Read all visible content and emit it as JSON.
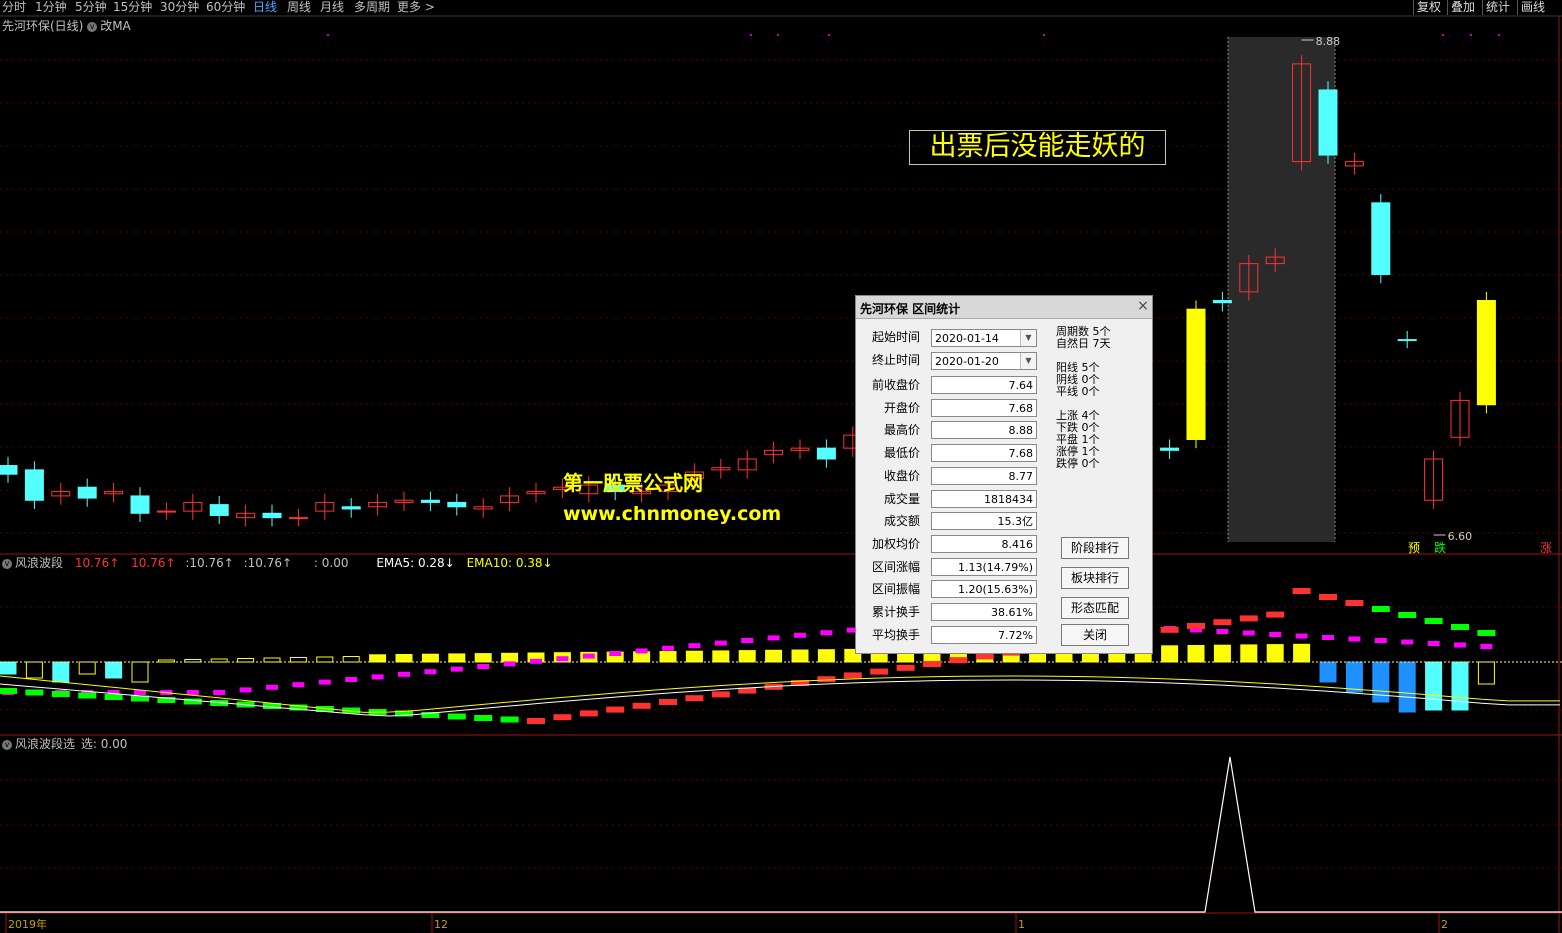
{
  "toolbar": {
    "periods": [
      "分时",
      "1分钟",
      "5分钟",
      "15分钟",
      "30分钟",
      "60分钟",
      "日线",
      "周线",
      "月线",
      "多周期",
      "更多 >"
    ],
    "active_period": "日线",
    "right_buttons": [
      "复权",
      "叠加",
      "统计",
      "画线"
    ]
  },
  "main_panel": {
    "title": "先河环保(日线)",
    "indicator": "改MA",
    "high_label": "8.88",
    "low_label": "6.60"
  },
  "annotation": "出票后没能走妖的",
  "watermark": {
    "line1": "第一股票公式网",
    "line2": "www.chnmoney.com"
  },
  "signals": {
    "yu": "预",
    "die": "跌",
    "zhang": "涨"
  },
  "sub_panel1": {
    "name": "风浪波段",
    "values": [
      "10.76↑",
      "10.76↑",
      ":10.76↑",
      ":10.76↑",
      ": 0.00"
    ],
    "ema5": "EMA5: 0.28↓",
    "ema10": "EMA10: 0.38↓"
  },
  "sub_panel2": {
    "name": "风浪波段选",
    "value": "选: 0.00"
  },
  "x_axis": [
    "2019年",
    "12",
    "1",
    "2"
  ],
  "dialog": {
    "title": "先河环保 区间统计",
    "start_label": "起始时间",
    "start_value": "2020-01-14",
    "end_label": "终止时间",
    "end_value": "2020-01-20",
    "fields": [
      {
        "label": "前收盘价",
        "value": "7.64"
      },
      {
        "label": "开盘价",
        "value": "7.68"
      },
      {
        "label": "最高价",
        "value": "8.88"
      },
      {
        "label": "最低价",
        "value": "7.68"
      },
      {
        "label": "收盘价",
        "value": "8.77"
      },
      {
        "label": "成交量",
        "value": "1818434"
      },
      {
        "label": "成交额",
        "value": "15.3亿"
      },
      {
        "label": "加权均价",
        "value": "8.416"
      },
      {
        "label": "区间涨幅",
        "value": "1.13(14.79%)"
      },
      {
        "label": "区间振幅",
        "value": "1.20(15.63%)"
      },
      {
        "label": "累计换手",
        "value": "38.61%"
      },
      {
        "label": "平均换手",
        "value": "7.72%"
      }
    ],
    "stats": [
      "周期数 5个",
      "自然日 7天",
      "阳线 5个",
      "阴线 0个",
      "平线 0个",
      "上涨 4个",
      "下跌 0个",
      "平盘 1个",
      "涨停 1个",
      "跌停 0个"
    ],
    "buttons": [
      "阶段排行",
      "板块排行",
      "形态匹配",
      "关闭"
    ]
  },
  "colors": {
    "up": "#ff3232",
    "down": "#54ffff",
    "yellow": "#ffff00",
    "magenta": "#ff00ff",
    "green": "#00ff00",
    "blue": "#1e90ff"
  },
  "chart_data": {
    "type": "candlestick",
    "candles_approx": [
      {
        "o": 6.92,
        "c": 6.88
      },
      {
        "o": 6.9,
        "c": 6.76
      },
      {
        "o": 6.78,
        "c": 6.8
      },
      {
        "o": 6.82,
        "c": 6.77
      },
      {
        "o": 6.79,
        "c": 6.8
      },
      {
        "o": 6.78,
        "c": 6.7
      },
      {
        "o": 6.71,
        "c": 6.71
      },
      {
        "o": 6.71,
        "c": 6.75
      },
      {
        "o": 6.74,
        "c": 6.69
      },
      {
        "o": 6.68,
        "c": 6.7
      },
      {
        "o": 6.7,
        "c": 6.68
      },
      {
        "o": 6.68,
        "c": 6.68
      },
      {
        "o": 6.71,
        "c": 6.75
      },
      {
        "o": 6.73,
        "c": 6.72
      },
      {
        "o": 6.73,
        "c": 6.75
      },
      {
        "o": 6.75,
        "c": 6.76
      },
      {
        "o": 6.76,
        "c": 6.75
      },
      {
        "o": 6.75,
        "c": 6.73
      },
      {
        "o": 6.72,
        "c": 6.73
      },
      {
        "o": 6.75,
        "c": 6.78
      },
      {
        "o": 6.79,
        "c": 6.8
      },
      {
        "o": 6.81,
        "c": 6.82
      },
      {
        "o": 6.79,
        "c": 6.83
      },
      {
        "o": 6.83,
        "c": 6.8
      },
      {
        "o": 6.79,
        "c": 6.8
      },
      {
        "o": 6.8,
        "c": 6.83
      },
      {
        "o": 6.86,
        "c": 6.89
      },
      {
        "o": 6.9,
        "c": 6.91
      },
      {
        "o": 6.9,
        "c": 6.95
      },
      {
        "o": 6.97,
        "c": 6.99
      },
      {
        "o": 6.99,
        "c": 7.0
      },
      {
        "o": 7.0,
        "c": 6.95
      },
      {
        "o": 7.0,
        "c": 7.06
      },
      {
        "o": 7.1,
        "c": 7.07
      },
      {
        "o": 7.1,
        "c": 7.08
      },
      {
        "o": 7.12,
        "c": 7.11
      },
      {
        "o": 7.1,
        "c": 7.13
      },
      {
        "o": 7.15,
        "c": 7.2
      },
      {
        "o": 7.19,
        "c": 7.17
      },
      {
        "o": 7.17,
        "c": 7.21
      },
      {
        "o": 7.22,
        "c": 7.22
      },
      {
        "o": 7.22,
        "c": 7.1
      },
      {
        "o": 7.13,
        "c": 7.12
      },
      {
        "o": 7.1,
        "c": 7.02
      },
      {
        "o": 7.0,
        "c": 6.99
      },
      {
        "o": 7.04,
        "c": 7.64
      },
      {
        "o": 7.68,
        "c": 7.67
      },
      {
        "o": 7.72,
        "c": 7.85
      },
      {
        "o": 7.85,
        "c": 7.88
      },
      {
        "o": 8.32,
        "c": 8.77
      },
      {
        "o": 8.65,
        "c": 8.35
      },
      {
        "o": 8.3,
        "c": 8.32
      },
      {
        "o": 8.13,
        "c": 7.8
      },
      {
        "o": 7.5,
        "c": 7.5
      },
      {
        "o": 6.76,
        "c": 6.95
      },
      {
        "o": 7.05,
        "c": 7.22
      },
      {
        "o": 7.2,
        "c": 7.68
      }
    ],
    "high": 8.88,
    "low": 6.6,
    "x_labels": [
      "2019年",
      "12",
      "1",
      "2"
    ]
  }
}
